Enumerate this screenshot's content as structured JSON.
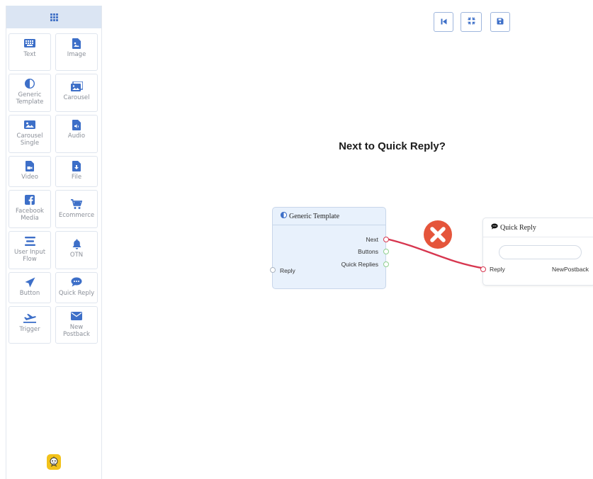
{
  "sidebar": {
    "tiles": [
      {
        "label": "Text",
        "icon": "keyboard-icon"
      },
      {
        "label": "Image",
        "icon": "image-file-icon"
      },
      {
        "label": "Generic Template",
        "icon": "half-circle-icon"
      },
      {
        "label": "Carousel",
        "icon": "images-icon"
      },
      {
        "label": "Carousel Single",
        "icon": "photo-icon"
      },
      {
        "label": "Audio",
        "icon": "audio-file-icon"
      },
      {
        "label": "Video",
        "icon": "video-file-icon"
      },
      {
        "label": "File",
        "icon": "download-file-icon"
      },
      {
        "label": "Facebook Media",
        "icon": "facebook-icon"
      },
      {
        "label": "Ecommerce",
        "icon": "cart-icon"
      },
      {
        "label": "User Input Flow",
        "icon": "lines-icon"
      },
      {
        "label": "OTN",
        "icon": "bell-icon"
      },
      {
        "label": "Button",
        "icon": "paper-plane-icon"
      },
      {
        "label": "Quick Reply",
        "icon": "chat-icon"
      },
      {
        "label": "Trigger",
        "icon": "plane-icon"
      },
      {
        "label": "New Postback",
        "icon": "envelope-icon"
      }
    ]
  },
  "canvas": {
    "title": "Next to Quick Reply?",
    "generic_template": {
      "title": "Generic Template",
      "outputs": [
        "Next",
        "Buttons",
        "Quick Replies"
      ],
      "input": "Reply"
    },
    "quick_reply": {
      "title": "Quick Reply",
      "input": "Reply",
      "output": "NewPostback"
    }
  },
  "colors": {
    "accent": "#3d6fc8",
    "connection": "#d7364f",
    "delete_badge": "#e5553b",
    "node_bg": "#e8f1fc"
  }
}
